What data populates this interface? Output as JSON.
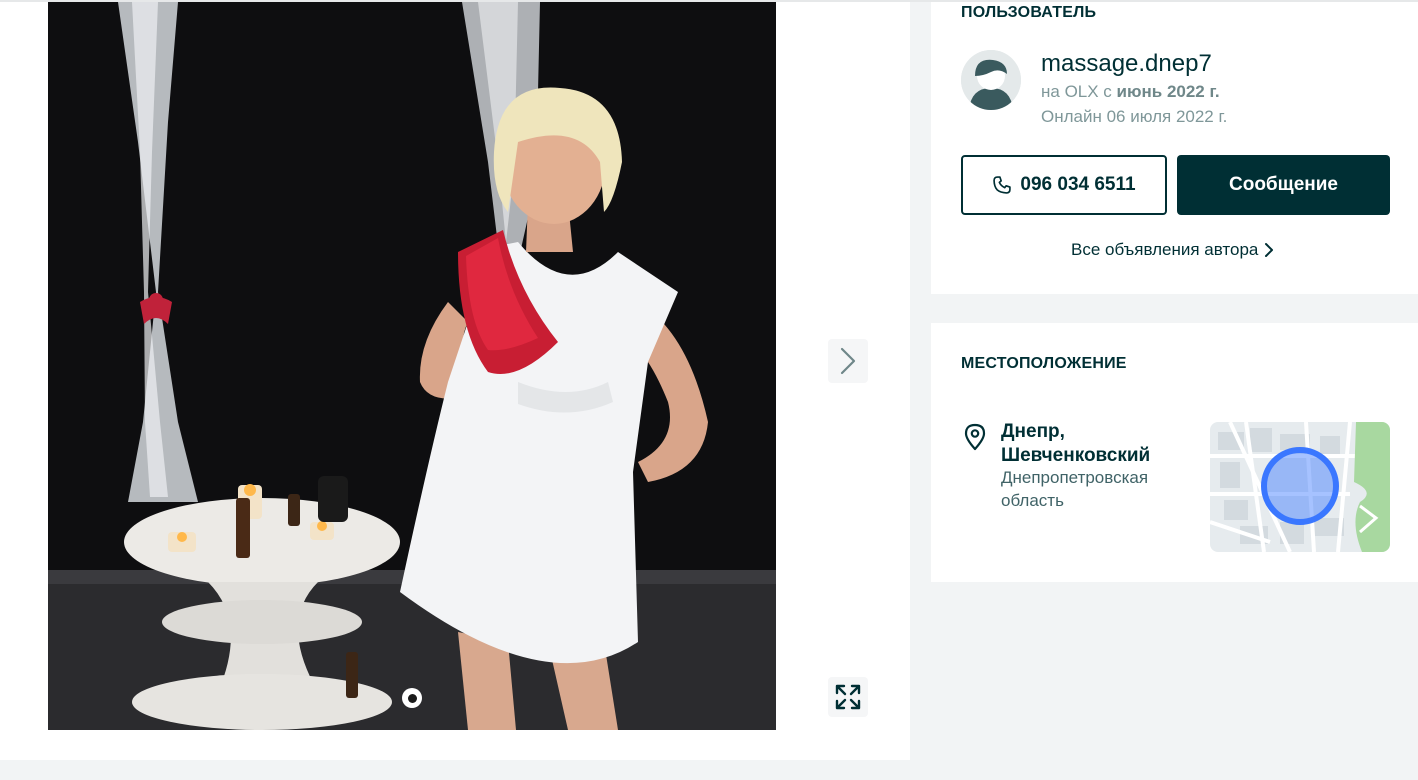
{
  "user": {
    "section_title": "ПОЛЬЗОВАТЕЛЬ",
    "username": "massage.dnep7",
    "since_prefix": "на OLX с ",
    "since_date": "июнь 2022 г.",
    "online": "Онлайн 06 июля 2022 г.",
    "phone": "096 034 6511",
    "message_label": "Сообщение",
    "all_ads_label": "Все объявления автора"
  },
  "location": {
    "section_title": "МЕСТОПОЛОЖЕНИЕ",
    "city": "Днепр, Шевченковский",
    "region": "Днепропетровская область"
  },
  "icons": {
    "phone": "phone-icon",
    "chevron": "chevron-right-icon",
    "pin": "map-pin-icon",
    "expand": "expand-icon"
  },
  "colors": {
    "primary": "#002f34",
    "muted": "#7f9799",
    "background": "#f2f4f5",
    "map_marker": "#3a77ff",
    "map_park": "#a8d8a0"
  }
}
